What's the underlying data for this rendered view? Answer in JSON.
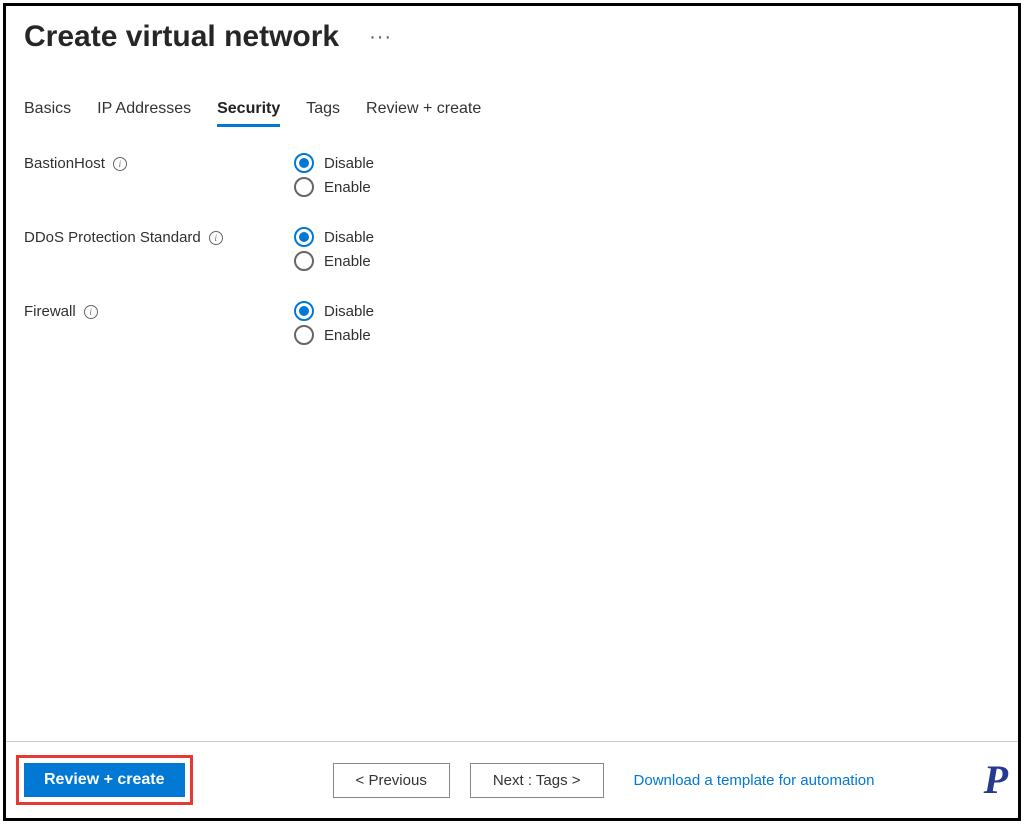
{
  "header": {
    "title": "Create virtual network"
  },
  "tabs": {
    "basics": "Basics",
    "ip": "IP Addresses",
    "security": "Security",
    "tags": "Tags",
    "review": "Review + create",
    "active": "security"
  },
  "form": {
    "bastion": {
      "label": "BastionHost",
      "options": {
        "disable": "Disable",
        "enable": "Enable"
      },
      "selected": "disable"
    },
    "ddos": {
      "label": "DDoS Protection Standard",
      "options": {
        "disable": "Disable",
        "enable": "Enable"
      },
      "selected": "disable"
    },
    "firewall": {
      "label": "Firewall",
      "options": {
        "disable": "Disable",
        "enable": "Enable"
      },
      "selected": "disable"
    }
  },
  "footer": {
    "review_create": "Review + create",
    "previous": "<  Previous",
    "next": "Next : Tags  >",
    "download_link": "Download a template for automation"
  }
}
